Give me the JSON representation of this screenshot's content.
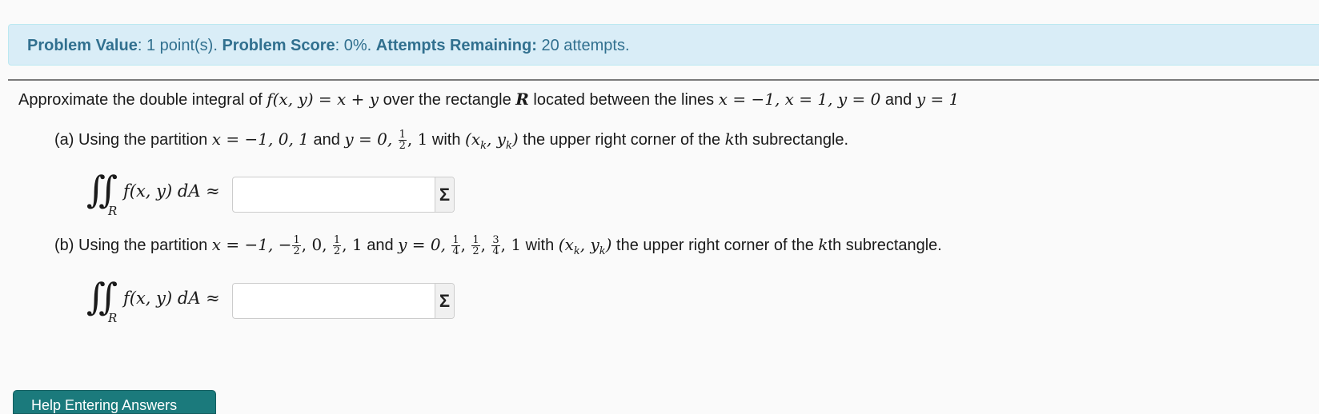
{
  "info": {
    "value_label": "Problem Value",
    "value_text": ": 1 point(s). ",
    "score_label": "Problem Score",
    "score_text": ": 0%. ",
    "attempts_label": "Attempts Remaining:",
    "attempts_text": " 20 attempts."
  },
  "problem": {
    "intro_1": "Approximate the double integral of ",
    "func": "f(x, y) = x + y",
    "intro_2": " over the rectangle ",
    "region": "R",
    "intro_3": " located between the lines ",
    "lines": "x = −1, x = 1, y = 0",
    "intro_and": " and ",
    "last_line": "y = 1",
    "part_a": {
      "lead": "(a) Using the partition ",
      "x_part": "x = −1, 0, 1",
      "and": " and ",
      "y_part": "y = 0, ",
      "frac_num": "1",
      "frac_den": "2",
      "y_tail": ", 1",
      "with": " with ",
      "point": "(x",
      "point_sub": "k",
      "point_mid": ", y",
      "point_sub2": "k",
      "point_end": ")",
      "tail": " the upper right corner of the ",
      "kth_k": "k",
      "kth_rest": "th subrectangle."
    },
    "part_b": {
      "lead": "(b) Using the partition ",
      "x_part": "x = −1, −",
      "x_frac1_num": "1",
      "x_frac1_den": "2",
      "x_mid": ", 0, ",
      "x_frac2_num": "1",
      "x_frac2_den": "2",
      "x_tail": ", 1",
      "and": " and ",
      "y_part": "y = 0, ",
      "y_frac1_num": "1",
      "y_frac1_den": "4",
      "y_frac2_num": "1",
      "y_frac2_den": "2",
      "y_frac3_num": "3",
      "y_frac3_den": "4",
      "y_tail": ", 1",
      "comma": ", ",
      "with": " with ",
      "point": "(x",
      "point_sub": "k",
      "point_mid": ", y",
      "point_sub2": "k",
      "point_end": ")",
      "tail": " the upper right corner of the ",
      "kth_k": "k",
      "kth_rest": "th subrectangle."
    },
    "integral_sign": "∬",
    "integral_sub": "R",
    "integral_expr": "f(x, y) dA ≈",
    "answer_a_value": "",
    "answer_b_value": "",
    "sigma_label": "Σ"
  },
  "help_button_label": "Help Entering Answers"
}
